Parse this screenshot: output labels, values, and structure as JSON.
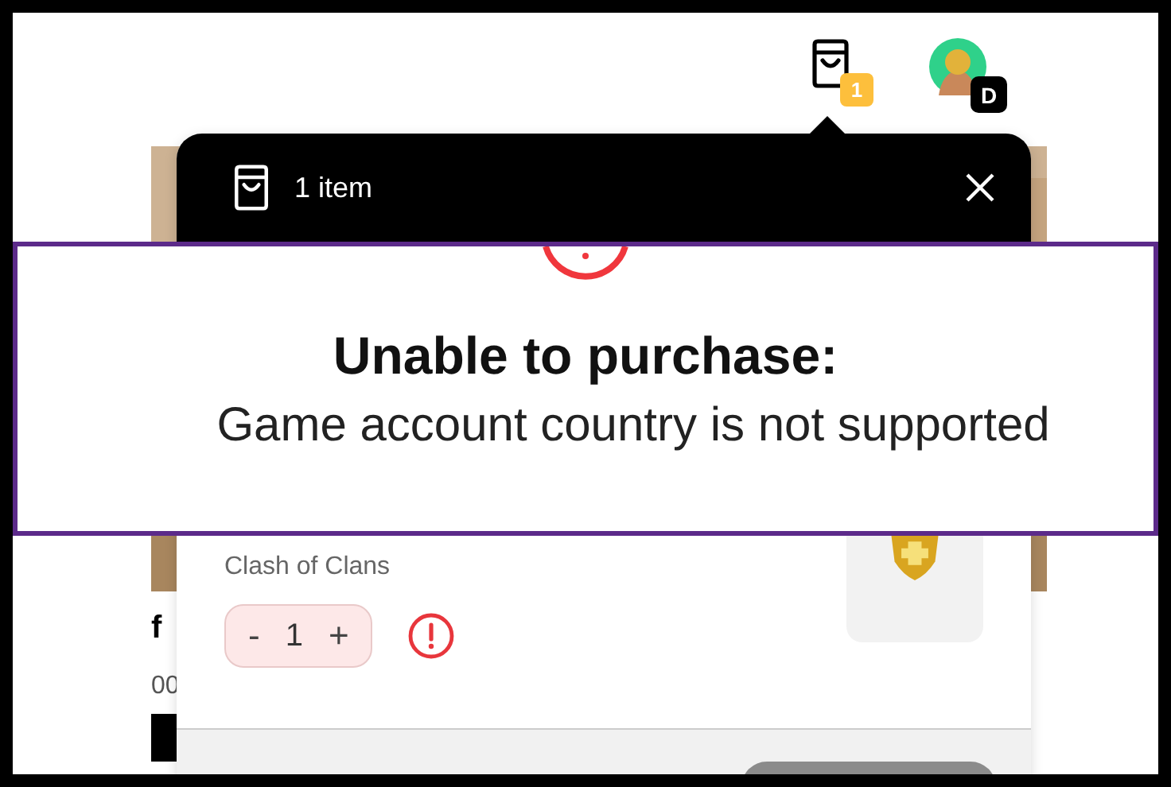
{
  "header": {
    "cart_badge": "1",
    "avatar_badge": "D"
  },
  "background_page": {
    "title_fragment": "f",
    "price_fragment": "00"
  },
  "cart_popup": {
    "title": "1 item",
    "items": [
      {
        "game": "Clash of Clans",
        "decrement": "-",
        "quantity": "1",
        "increment": "+",
        "error": true
      }
    ]
  },
  "banner": {
    "title": "Unable to purchase:",
    "message": "Game account country is not supported"
  }
}
